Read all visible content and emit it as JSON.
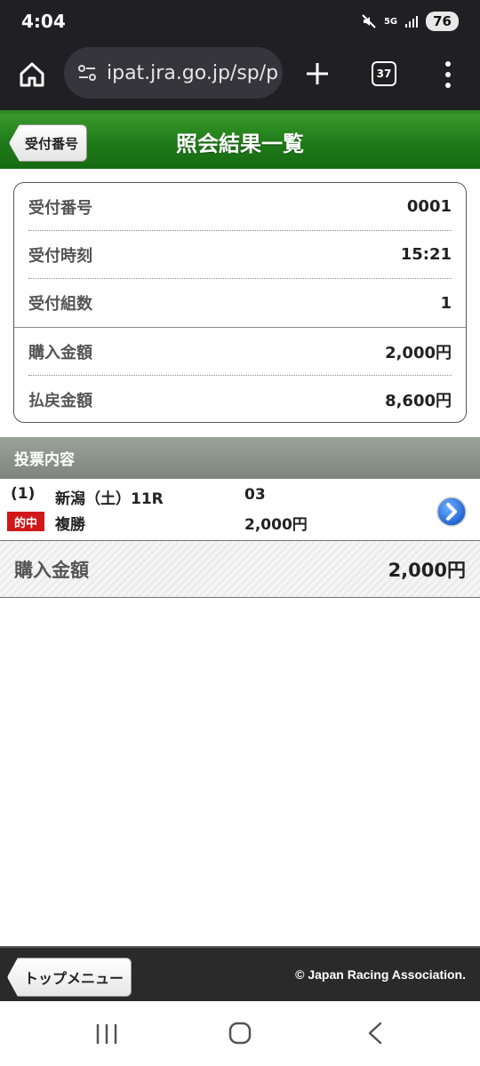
{
  "status_bar": {
    "time": "4:04",
    "network": "5G",
    "battery": "76"
  },
  "browser": {
    "url": "ipat.jra.go.jp/sp/p",
    "tab_count": "37"
  },
  "header": {
    "back_label": "受付番号",
    "title": "照会結果一覧",
    "accent_color": "#1e7a18"
  },
  "summary": {
    "receipt_number_label": "受付番号",
    "receipt_number": "0001",
    "receipt_time_label": "受付時刻",
    "receipt_time": "15:21",
    "set_count_label": "受付組数",
    "set_count": "1",
    "purchase_amount_label": "購入金額",
    "purchase_amount": "2,000円",
    "payout_amount_label": "払戻金額",
    "payout_amount": "8,600円"
  },
  "bets_section": {
    "title": "投票内容",
    "items": [
      {
        "index": "(1)",
        "badge": "的中",
        "race": "新潟（土）11R",
        "bet_type": "複勝",
        "combination": "03",
        "amount": "2,000円"
      }
    ]
  },
  "total": {
    "label": "購入金額",
    "value": "2,000円"
  },
  "footer": {
    "top_menu_label": "トップメニュー",
    "copyright": "© Japan Racing Association."
  }
}
